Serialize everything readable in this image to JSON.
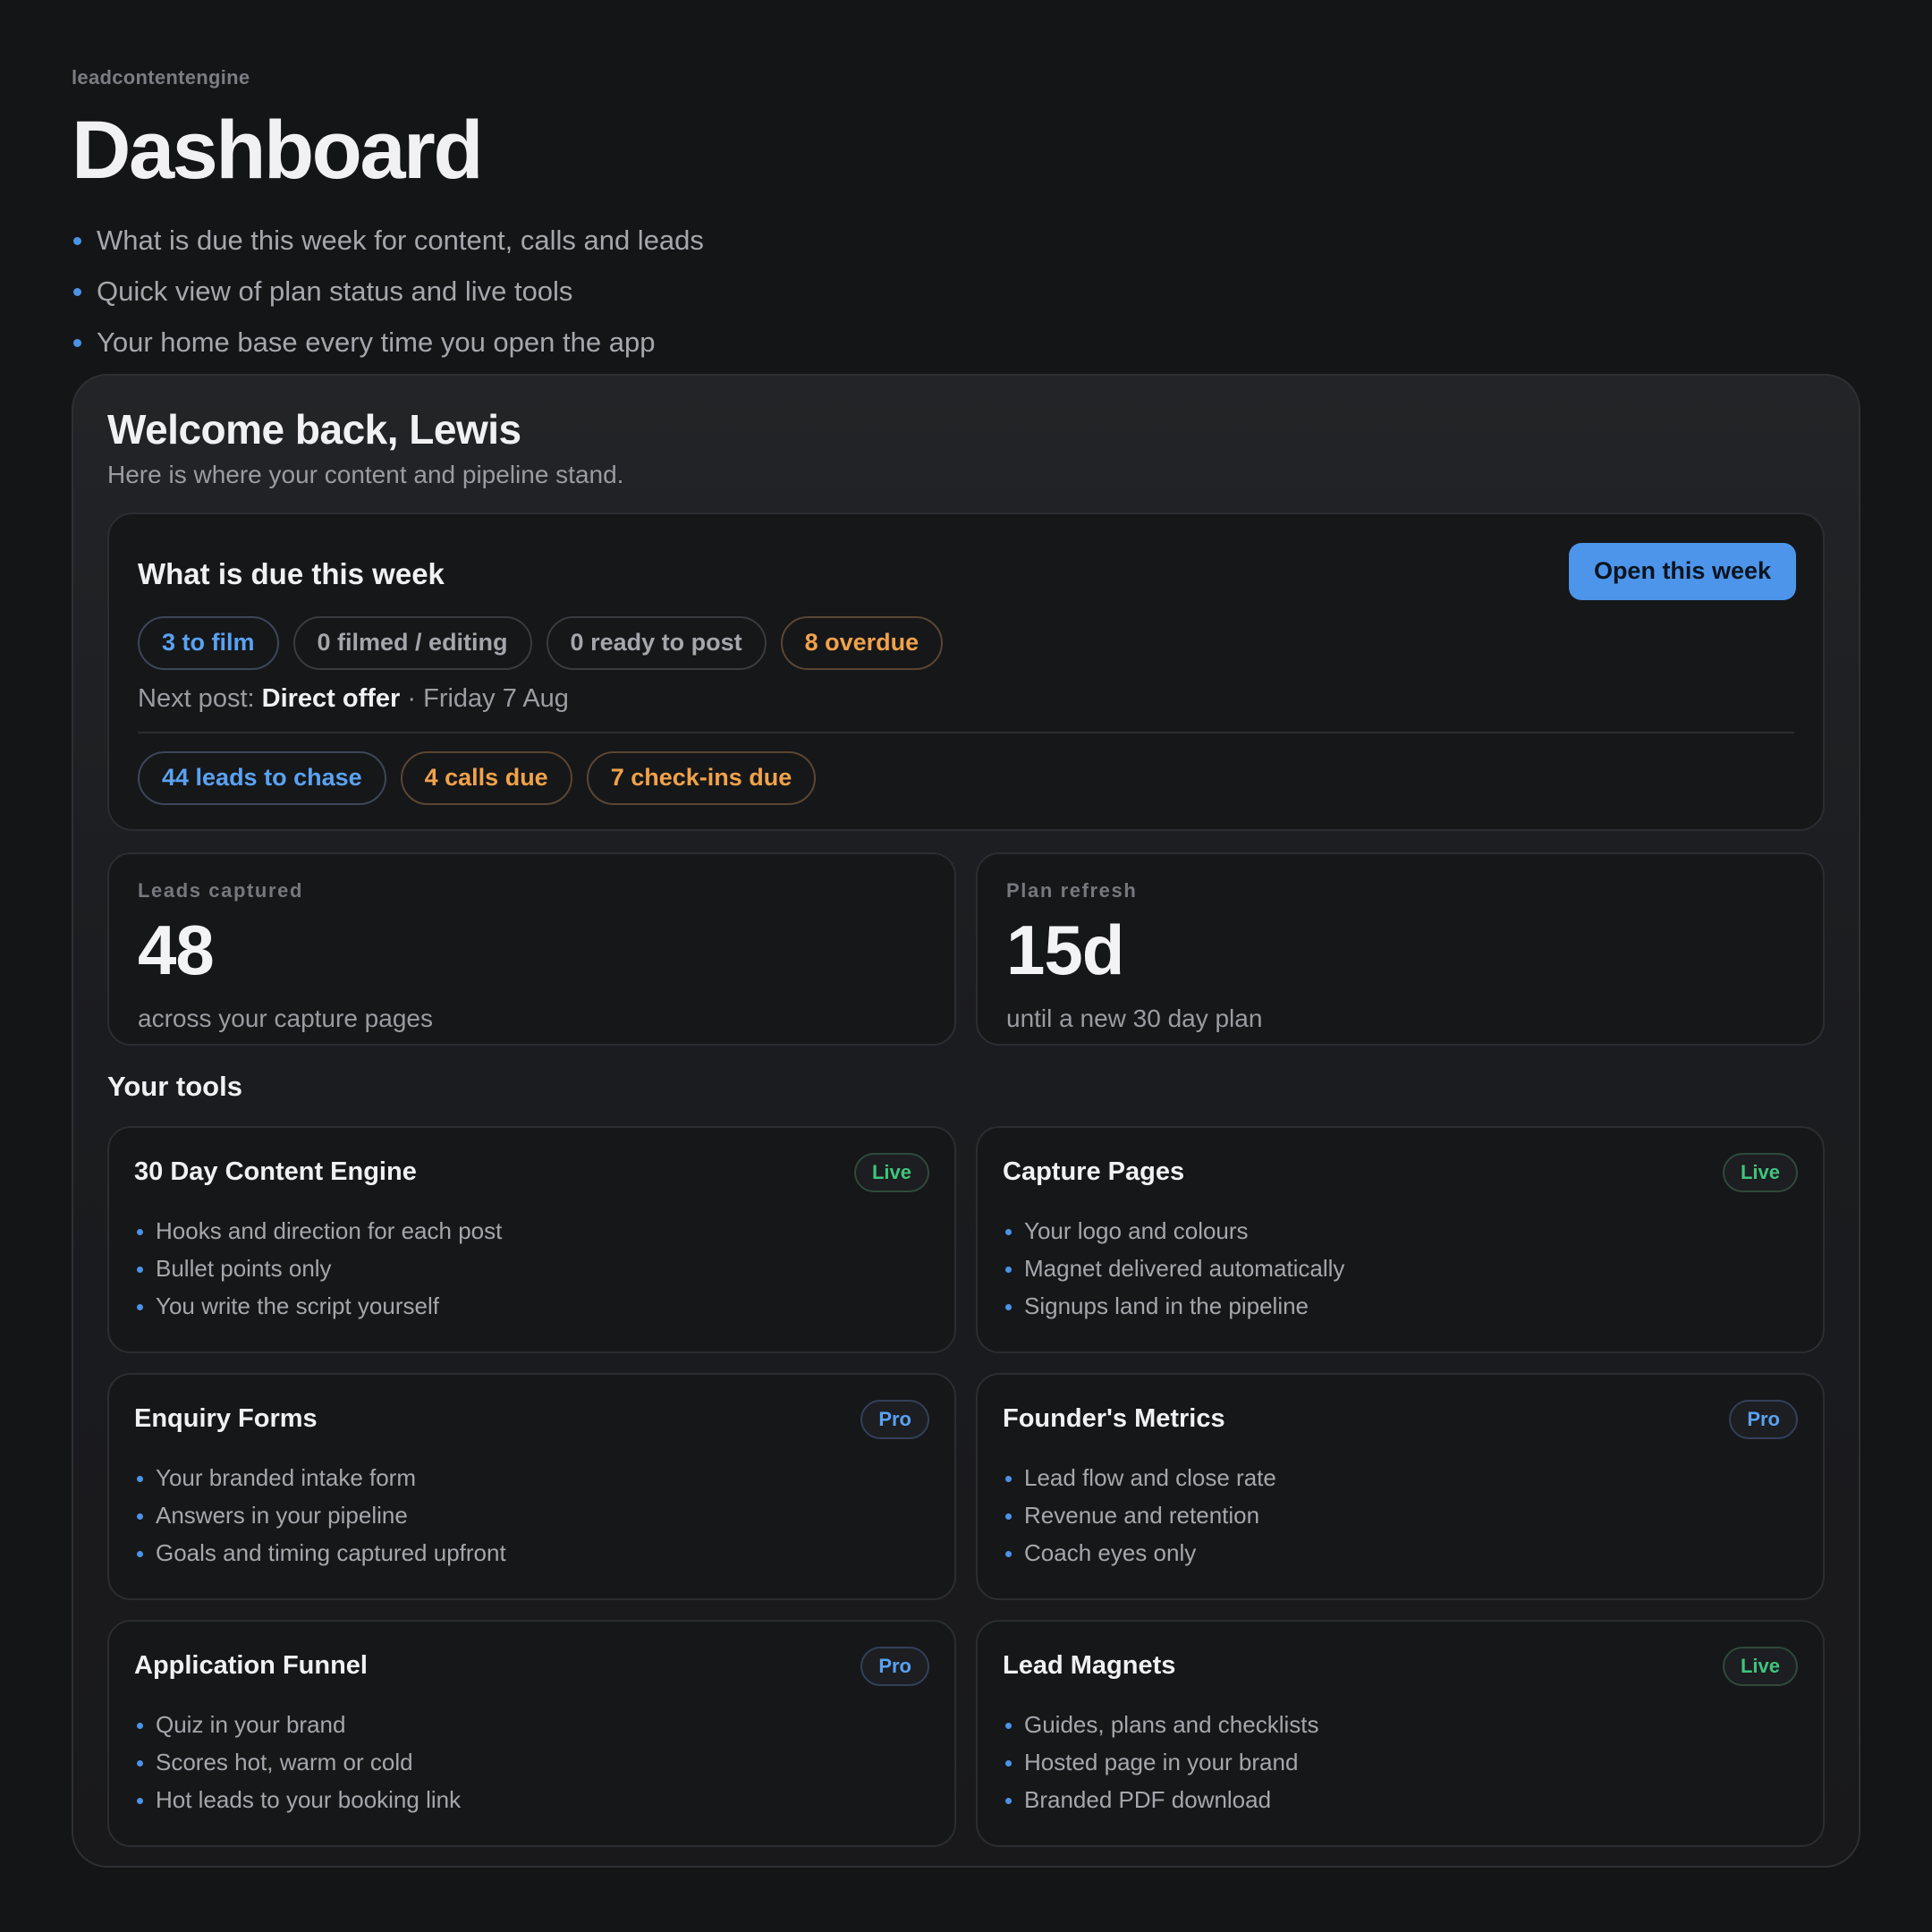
{
  "app": {
    "brand": "leadcontentengine",
    "title": "Dashboard"
  },
  "intro": [
    "What is due this week for content, calls and leads",
    "Quick view of plan status and live tools",
    "Your home base every time you open the app"
  ],
  "welcome": {
    "heading": "Welcome back, Lewis",
    "subtitle": "Here is where your content and pipeline stand."
  },
  "due": {
    "title": "What is due this week",
    "button": "Open this week",
    "content_pills": [
      "3 to film",
      "0 filmed / editing",
      "0 ready to post",
      "8 overdue"
    ],
    "next_post_prefix": "Next post:",
    "next_post_title": "Direct offer",
    "next_post_date": " · Friday 7 Aug",
    "pipeline_pills": [
      "44 leads to chase",
      "4 calls due",
      "7 check-ins due"
    ]
  },
  "stats": [
    {
      "label": "Leads captured",
      "value": "48",
      "sub": "across your capture pages"
    },
    {
      "label": "Plan refresh",
      "value": "15d",
      "sub": "until a new 30 day plan"
    }
  ],
  "tools_title": "Your tools",
  "tools": [
    {
      "title": "30 Day Content Engine",
      "badge": "Live",
      "items": [
        "Hooks and direction for each post",
        "Bullet points only",
        "You write the script yourself"
      ]
    },
    {
      "title": "Capture Pages",
      "badge": "Live",
      "items": [
        "Your logo and colours",
        "Magnet delivered automatically",
        "Signups land in the pipeline"
      ]
    },
    {
      "title": "Enquiry Forms",
      "badge": "Pro",
      "items": [
        "Your branded intake form",
        "Answers in your pipeline",
        "Goals and timing captured upfront"
      ]
    },
    {
      "title": "Founder's Metrics",
      "badge": "Pro",
      "items": [
        "Lead flow and close rate",
        "Revenue and retention",
        "Coach eyes only"
      ]
    },
    {
      "title": "Application Funnel",
      "badge": "Pro",
      "items": [
        "Quiz in your brand",
        "Scores hot, warm or cold",
        "Hot leads to your booking link"
      ]
    },
    {
      "title": "Lead Magnets",
      "badge": "Live",
      "items": [
        "Guides, plans and checklists",
        "Hosted page in your brand",
        "Branded PDF download"
      ]
    }
  ],
  "colors": {
    "accent": "#4c95ea",
    "warning": "#f0a24a",
    "live": "#3fc57d",
    "background": "#141517"
  }
}
